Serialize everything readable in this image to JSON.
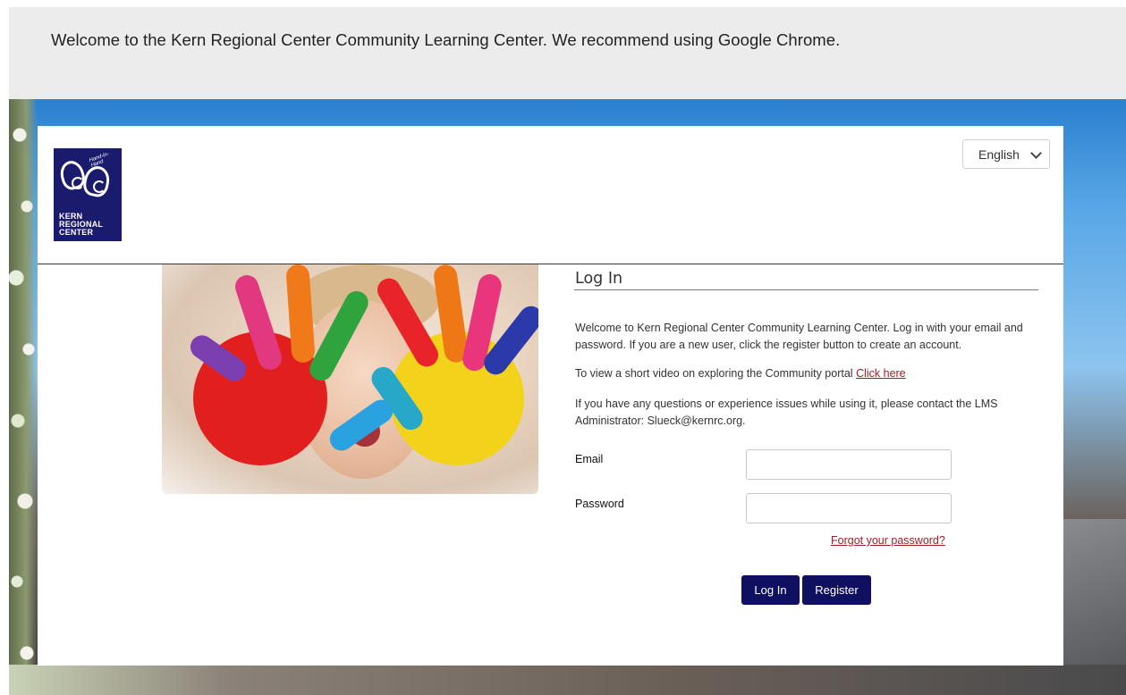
{
  "banner": {
    "text": "Welcome to the Kern Regional Center Community Learning Center. We recommend using Google Chrome."
  },
  "language": {
    "selected": "English"
  },
  "logo": {
    "tagline": "Hand-in-Hand",
    "line1": "KERN",
    "line2": "REGIONAL",
    "line3": "CENTER",
    "color": "#1b1b6e"
  },
  "login": {
    "title": "Log In",
    "intro": "Welcome to Kern Regional Center Community Learning Center. Log in with your email and password. If you are a new user, click the register button to create an account.",
    "video_text": "To view a short video on exploring the Community portal",
    "video_link": "Click here",
    "contact": "If you have any questions or experience issues while using it, please contact the LMS Administrator: Slueck@kernrc.org.",
    "email_label": "Email",
    "email_value": "",
    "password_label": "Password",
    "password_value": "",
    "forgot_link": "Forgot your password?",
    "login_button": "Log In",
    "register_button": "Register"
  },
  "colors": {
    "button": "#101060",
    "link": "#a31d25",
    "banner_bg": "#ececec"
  },
  "icons": {
    "language_dropdown": "chevron-down-icon"
  }
}
